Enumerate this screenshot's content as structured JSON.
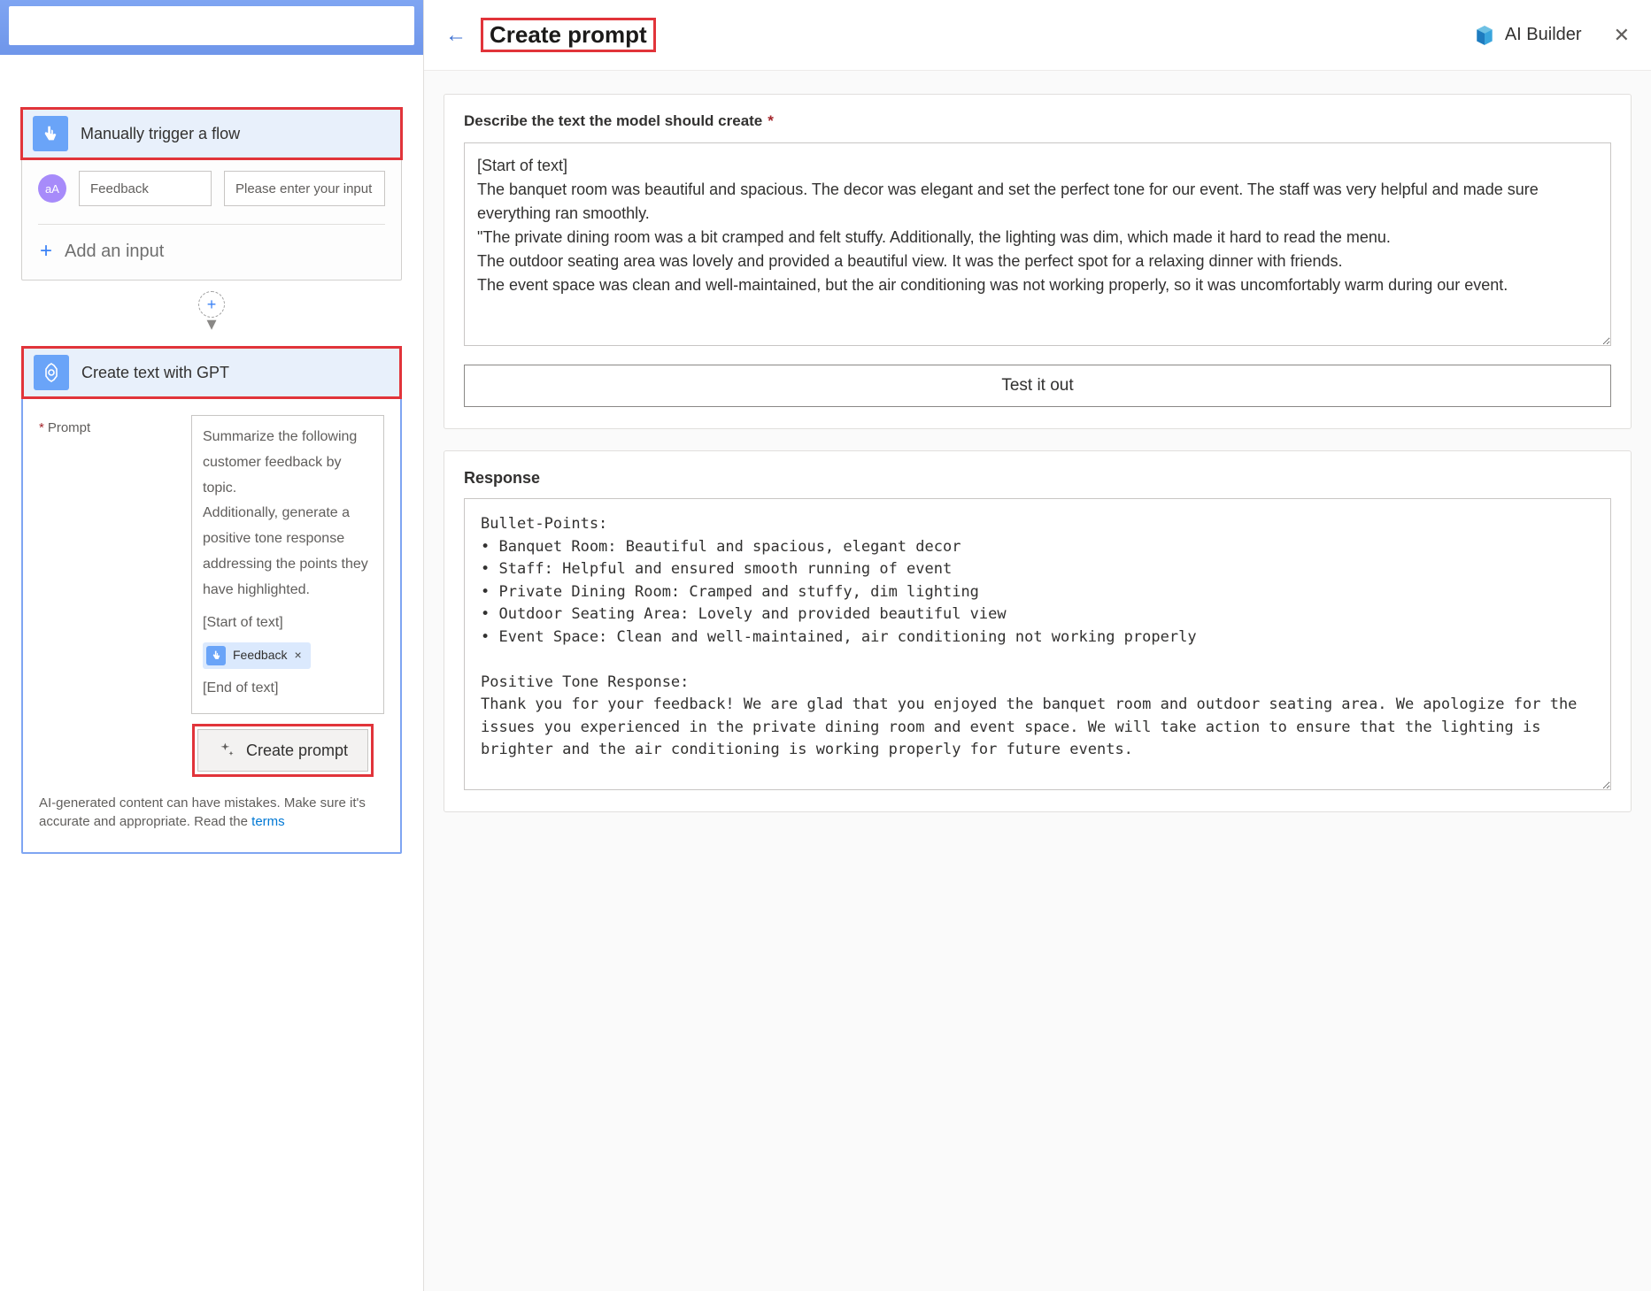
{
  "topbar": {
    "search_placeholder": ""
  },
  "flow": {
    "trigger": {
      "title": "Manually trigger a flow",
      "aa_label": "aA",
      "field_name": "Feedback",
      "field_placeholder": "Please enter your input",
      "add_input": "Add an input"
    },
    "gpt": {
      "title": "Create text with GPT",
      "prompt_label": "Prompt",
      "prompt_text_top": "Summarize the following customer feedback by topic.\nAdditionally, generate a positive tone response addressing the points they have highlighted.",
      "start_marker": "[Start of text]",
      "feedback_chip": "Feedback",
      "end_marker": "[End of text]",
      "create_prompt_btn": "Create prompt",
      "disclaimer_pre": "AI-generated content can have mistakes. Make sure it's accurate and appropriate. Read the ",
      "disclaimer_link": "terms"
    }
  },
  "panel": {
    "title": "Create prompt",
    "brand": "AI Builder",
    "describe_label": "Describe the text the model should create",
    "describe_value": "[Start of text]\nThe banquet room was beautiful and spacious. The decor was elegant and set the perfect tone for our event. The staff was very helpful and made sure everything ran smoothly.\n\"The private dining room was a bit cramped and felt stuffy. Additionally, the lighting was dim, which made it hard to read the menu.\nThe outdoor seating area was lovely and provided a beautiful view. It was the perfect spot for a relaxing dinner with friends.\nThe event space was clean and well-maintained, but the air conditioning was not working properly, so it was uncomfortably warm during our event.",
    "test_btn": "Test it out",
    "response_label": "Response",
    "response_value": "Bullet-Points:\n• Banquet Room: Beautiful and spacious, elegant decor\n• Staff: Helpful and ensured smooth running of event\n• Private Dining Room: Cramped and stuffy, dim lighting\n• Outdoor Seating Area: Lovely and provided beautiful view\n• Event Space: Clean and well-maintained, air conditioning not working properly\n\nPositive Tone Response:\nThank you for your feedback! We are glad that you enjoyed the banquet room and outdoor seating area. We apologize for the issues you experienced in the private dining room and event space. We will take action to ensure that the lighting is brighter and the air conditioning is working properly for future events."
  }
}
